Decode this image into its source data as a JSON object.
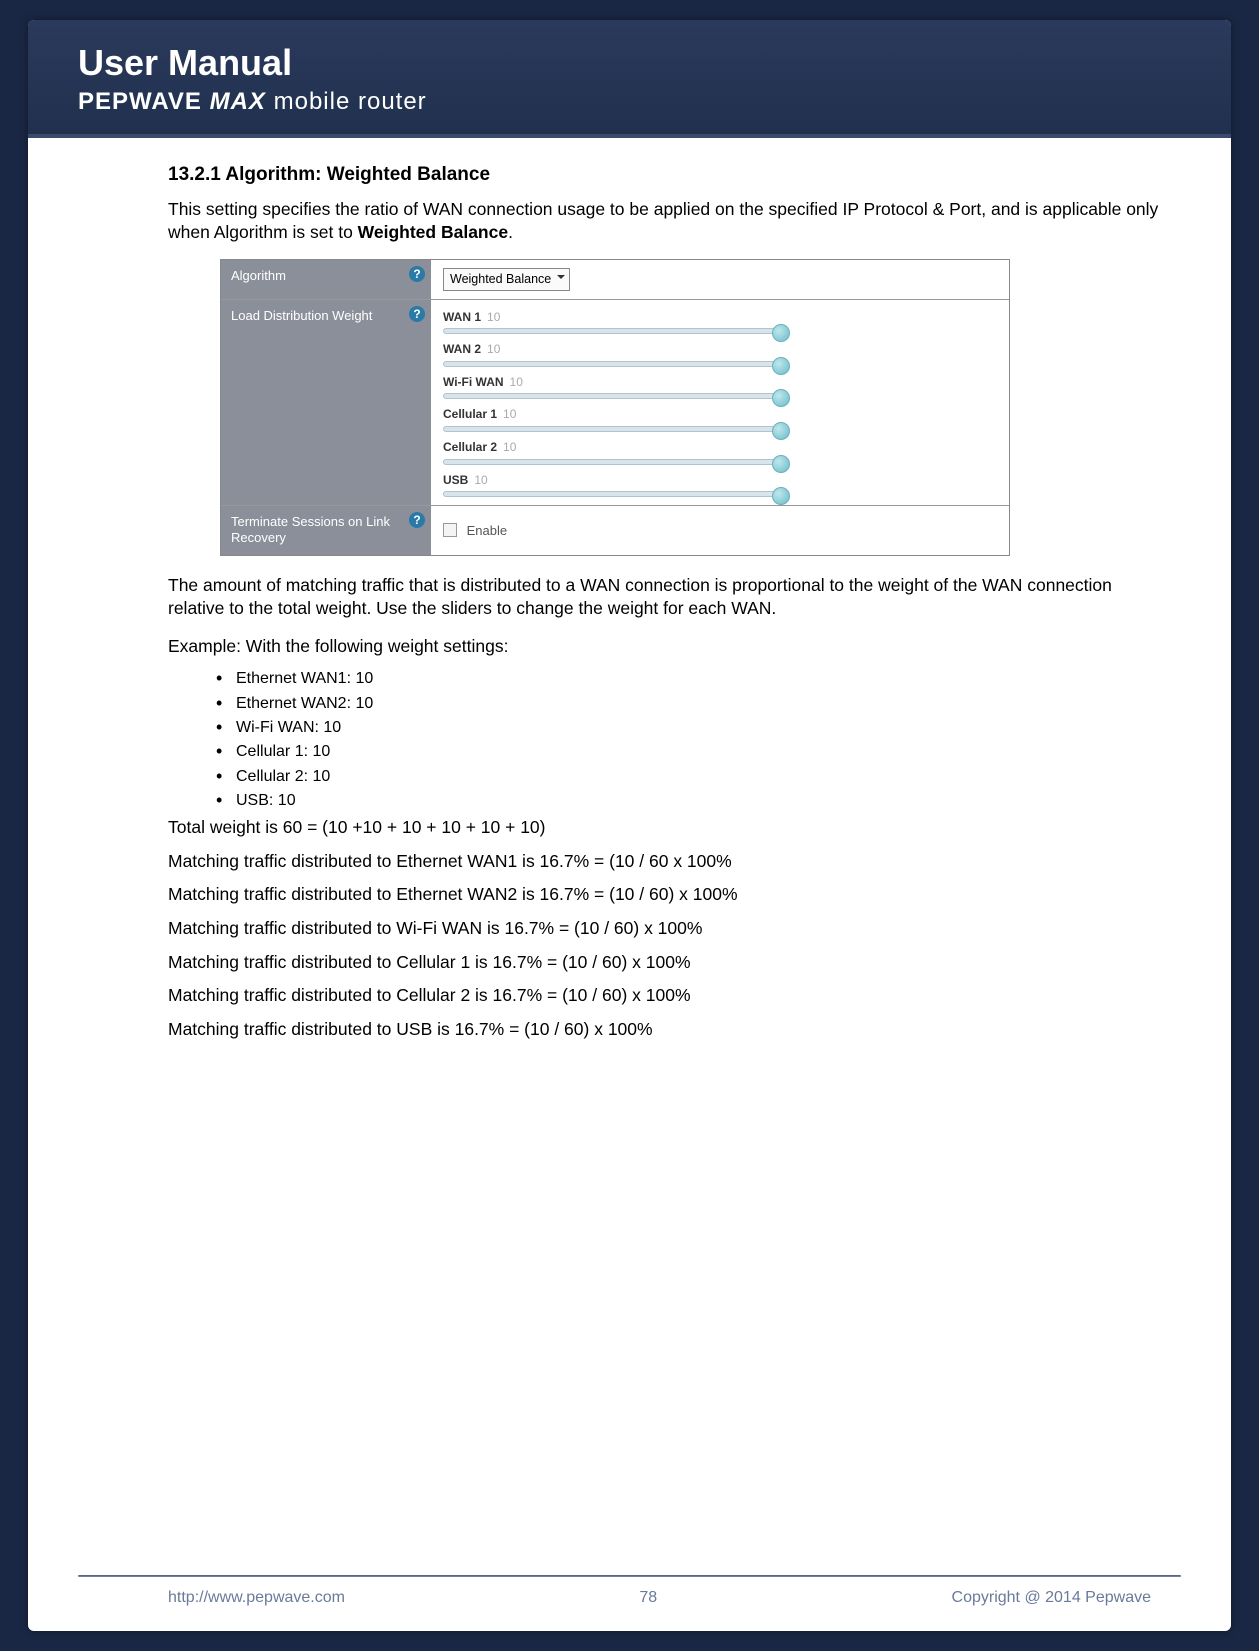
{
  "header": {
    "title": "User Manual",
    "brand": "PEPWAVE",
    "model": "MAX",
    "tag": "mobile router"
  },
  "section": {
    "number": "13.2.1",
    "title": "Algorithm: Weighted Balance",
    "intro_a": "This setting specifies the ratio of WAN connection usage to be applied on the specified IP Protocol & Port, and is applicable only when Algorithm is set to ",
    "intro_bold": "Weighted Balance",
    "intro_b": "."
  },
  "config": {
    "rows": [
      {
        "label": "Algorithm",
        "value": "Weighted Balance"
      },
      {
        "label": "Load Distribution Weight",
        "wans": [
          {
            "name": "WAN 1",
            "val": "10"
          },
          {
            "name": "WAN 2",
            "val": "10"
          },
          {
            "name": "Wi-Fi WAN",
            "val": "10"
          },
          {
            "name": "Cellular 1",
            "val": "10"
          },
          {
            "name": "Cellular 2",
            "val": "10"
          },
          {
            "name": "USB",
            "val": "10"
          }
        ]
      },
      {
        "label": "Terminate Sessions on Link Recovery",
        "enable": "Enable"
      }
    ]
  },
  "explain": "The amount of matching traffic that is distributed to a WAN connection is proportional to the weight of the WAN connection relative to the total weight. Use the sliders to change the weight for each WAN.",
  "example_label": "Example: With the following weight settings:",
  "bullets": [
    "Ethernet WAN1:  10",
    "Ethernet WAN2: 10",
    "Wi-Fi WAN: 10",
    "Cellular 1: 10",
    "Cellular 2: 10",
    "USB:      10"
  ],
  "total": "Total weight is 60 = (10 +10 + 10 + 10 + 10 + 10)",
  "calcs": [
    "Matching traffic distributed to Ethernet WAN1 is 16.7% = (10 / 60 x 100%",
    "Matching traffic distributed to Ethernet WAN2 is 16.7% = (10 / 60) x 100%",
    "Matching traffic distributed to Wi-Fi WAN is 16.7% = (10 / 60) x 100%",
    "Matching traffic distributed to Cellular 1 is 16.7% = (10 / 60) x 100%",
    "Matching traffic distributed to Cellular 2 is 16.7% = (10 / 60) x 100%",
    "Matching traffic distributed to USB is 16.7% = (10 / 60) x 100%"
  ],
  "footer": {
    "url": "http://www.pepwave.com",
    "page": "78",
    "copyright": "Copyright @ 2014 Pepwave"
  }
}
